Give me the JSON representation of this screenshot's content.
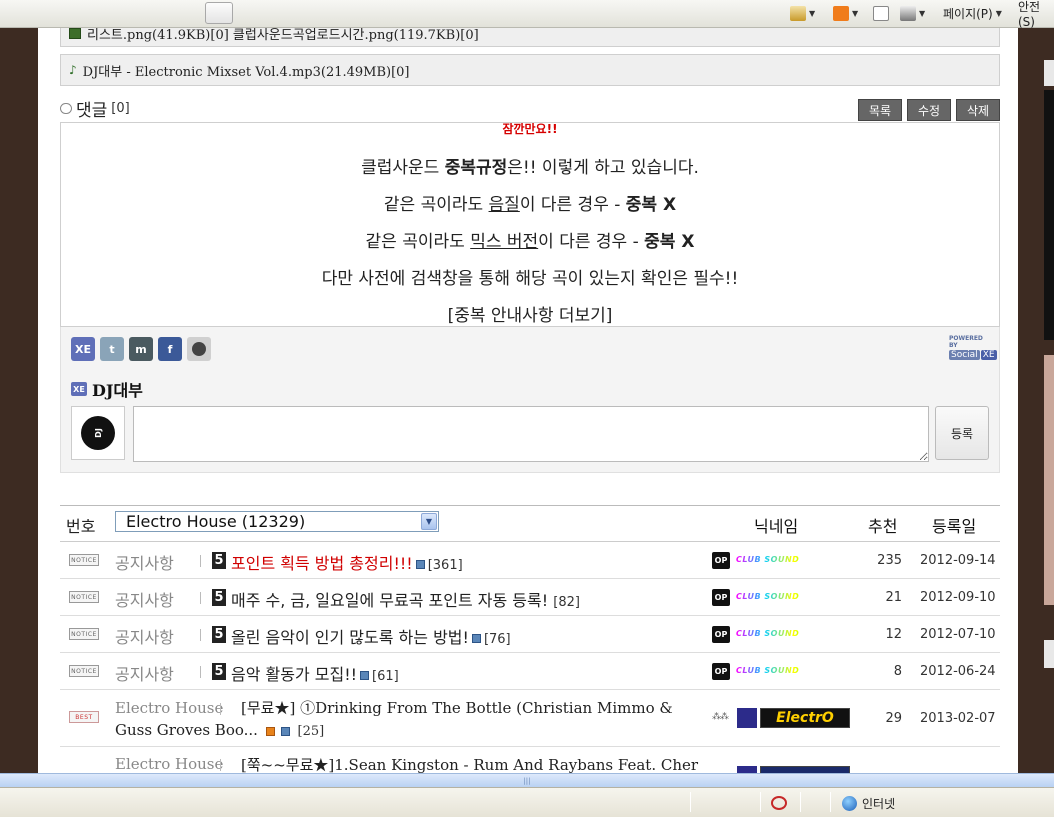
{
  "ie_toolbar": {
    "page_menu": "페이지(P)",
    "safety_menu": "안전(S)"
  },
  "files": {
    "images_line": "리스트.png(41.9KB)[0]  클럽사운드곡업로드시간.png(119.7KB)[0]",
    "mp3_line": "DJ대부 - Electronic Mixset Vol.4.mp3(21.49MB)[0]"
  },
  "comments": {
    "title": "댓글",
    "count": "[0]",
    "buttons": {
      "list": "목록",
      "edit": "수정",
      "delete": "삭제"
    }
  },
  "notice": {
    "top": "잠깐만요!!",
    "line1_pre": "클럽사운드 ",
    "line1_bold": "중복규정",
    "line1_post": "은!! 이렇게 하고 있습니다.",
    "line2_pre": "같은 곡이라도 ",
    "line2_u": "음질",
    "line2_mid": "이 다른 경우 - ",
    "line2_bold": "중복 X",
    "line3_pre": "같은 곡이라도 ",
    "line3_u": "믹스 버전",
    "line3_mid": "이 다른 경우 - ",
    "line3_bold": "중복 X",
    "line4": "다만 사전에 검색창을 통해 해당 곡이 있는지 확인은 필수!!",
    "line5": "[중복 안내사항 더보기]"
  },
  "social": {
    "powered_by": "POWERED BY",
    "powered_brand": "Social",
    "powered_xe": "XE",
    "xe_badge": "XE",
    "username": "DJ대부",
    "submit_label": "등록",
    "comment_placeholder": ""
  },
  "list": {
    "header": {
      "number": "번호",
      "category_select": "Electro House (12329)",
      "nickname": "닉네임",
      "recommend": "추천",
      "date": "등록일"
    },
    "rows": [
      {
        "badge": "NOTICE",
        "category": "공지사항",
        "title": "포인트 획득 방법 총정리!!!",
        "comments": "[361]",
        "recommend": "235",
        "date": "2012-09-14"
      },
      {
        "badge": "NOTICE",
        "category": "공지사항",
        "title": "매주 수, 금, 일요일에 무료곡 포인트 자동 등록!",
        "comments": "[82]",
        "recommend": "21",
        "date": "2012-09-10"
      },
      {
        "badge": "NOTICE",
        "category": "공지사항",
        "title": "올린 음악이 인기 많도록 하는 방법!",
        "comments": "[76]",
        "recommend": "12",
        "date": "2012-07-10"
      },
      {
        "badge": "NOTICE",
        "category": "공지사항",
        "title": "음악 활동가 모집!!",
        "comments": "[61]",
        "recommend": "8",
        "date": "2012-06-24"
      },
      {
        "badge": "BEST",
        "category": "Electro House",
        "title": "[무료★] ①Drinking From The Bottle (Christian Mimmo & Guss Groves Boo...",
        "comments": "[25]",
        "recommend": "29",
        "date": "2013-02-07",
        "nick_logo": "ElectrO"
      },
      {
        "badge": "",
        "category": "Electro House",
        "title": "[쭉~~무료★]1.Sean Kingston - Rum And Raybans Feat. Cher",
        "comments": "",
        "recommend": "",
        "date": ""
      }
    ],
    "nick_logo": "CLUB SOUND",
    "op_badge": "OP",
    "num_badge": "5"
  },
  "statusbar": {
    "zone": "인터넷"
  },
  "colors": {
    "notice_red": "#d00000",
    "button_gray": "#666666",
    "xe_blue": "#5f6fb8"
  }
}
